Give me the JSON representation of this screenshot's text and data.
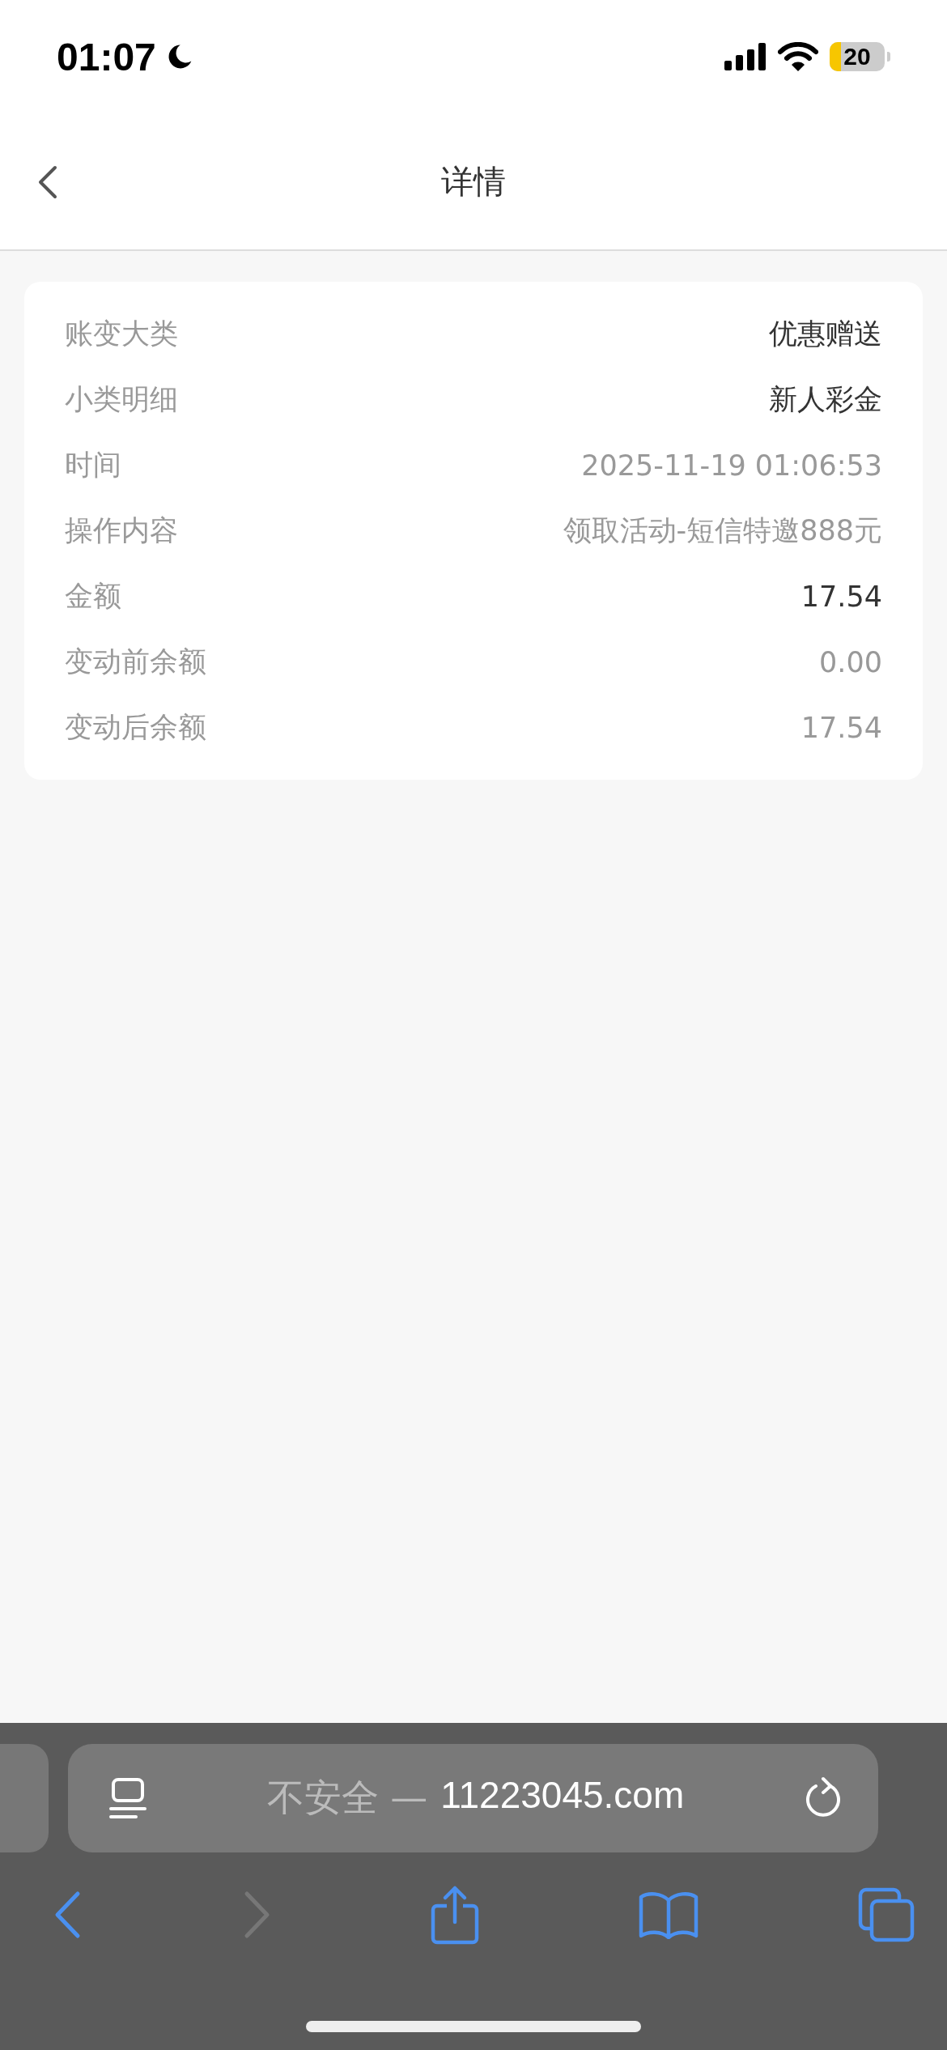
{
  "status_bar": {
    "time": "01:07",
    "battery": "20"
  },
  "header": {
    "title": "详情"
  },
  "details": [
    {
      "label": "账变大类",
      "value": "优惠赠送",
      "emphasized": true
    },
    {
      "label": "小类明细",
      "value": "新人彩金",
      "emphasized": true
    },
    {
      "label": "时间",
      "value": "2025-11-19 01:06:53",
      "emphasized": false
    },
    {
      "label": "操作内容",
      "value": "领取活动-短信特邀888元",
      "emphasized": false
    },
    {
      "label": "金额",
      "value": "17.54",
      "emphasized": true
    },
    {
      "label": "变动前余额",
      "value": "0.00",
      "emphasized": false
    },
    {
      "label": "变动后余额",
      "value": "17.54",
      "emphasized": false
    }
  ],
  "browser": {
    "security_label": "不安全 —",
    "domain": "11223045.com",
    "back_disabled": false,
    "forward_disabled": true
  }
}
